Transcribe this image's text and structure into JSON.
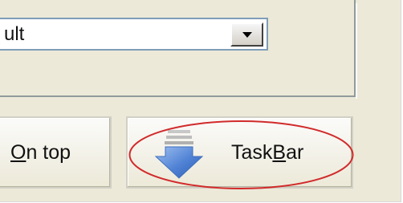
{
  "combo": {
    "selected_value": "ult"
  },
  "buttons": {
    "on_top": {
      "label_accel": "O",
      "label_rest": "n top"
    },
    "taskbar": {
      "label_pre": "Task",
      "label_accel": "B",
      "label_post": "ar",
      "icon": "down-arrow-icon"
    }
  },
  "colors": {
    "dialog_background": "#ece9d8",
    "combo_border": "#7f9db9",
    "arrow_blue": "#4f81d4",
    "highlight_red": "#d12b2b"
  }
}
